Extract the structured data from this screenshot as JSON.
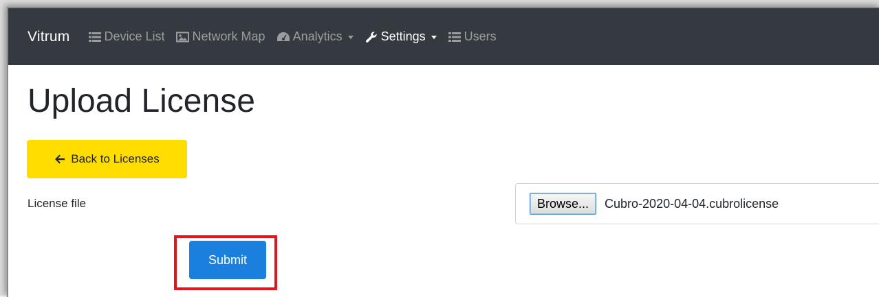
{
  "navbar": {
    "brand": "Vitrum",
    "items": [
      {
        "label": "Device List",
        "icon": "list-icon",
        "active": false,
        "dropdown": false
      },
      {
        "label": "Network Map",
        "icon": "image-icon",
        "active": false,
        "dropdown": false
      },
      {
        "label": "Analytics",
        "icon": "tachometer-icon",
        "active": false,
        "dropdown": true
      },
      {
        "label": "Settings",
        "icon": "wrench-icon",
        "active": true,
        "dropdown": true
      },
      {
        "label": "Users",
        "icon": "list-icon",
        "active": false,
        "dropdown": false
      }
    ],
    "colors": {
      "background": "#343a40",
      "text_active": "#ffffff",
      "text_muted": "rgba(255,255,255,0.5)"
    }
  },
  "page": {
    "title": "Upload License",
    "back_button": {
      "label": "Back to Licenses",
      "icon": "arrow-left-icon",
      "color": "#ffdd00"
    },
    "license_field": {
      "label": "License file",
      "browse_label": "Browse...",
      "file_name": "Cubro-2020-04-04.cubrolicense"
    },
    "submit_button": {
      "label": "Submit",
      "color": "#1a7fdd"
    },
    "highlight_color": "#e8141b"
  }
}
